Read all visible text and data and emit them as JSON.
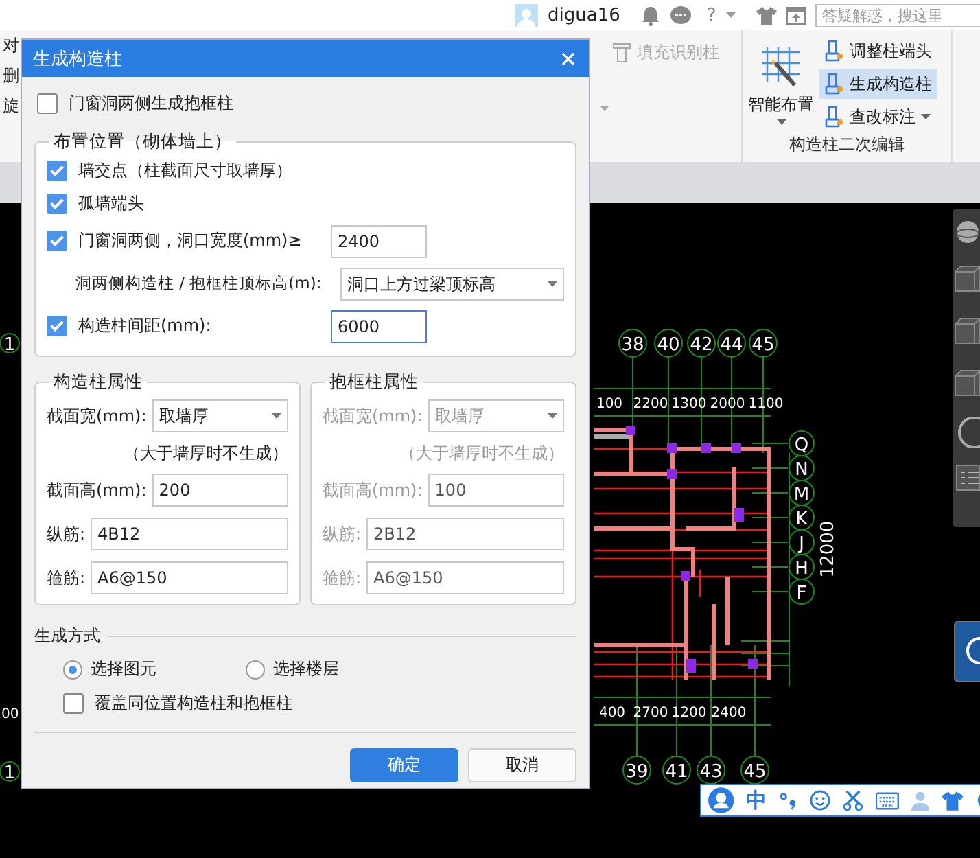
{
  "topbar": {
    "user": "digua16",
    "help": "?",
    "search": {
      "placeholder": "答疑解惑，搜这里"
    }
  },
  "ribbon": {
    "left_items": [
      "对",
      "删",
      "旋"
    ],
    "fill_button": {
      "label": "填充识别柱",
      "disabled": true
    },
    "smart_layout": "智能布置",
    "edit_items": [
      {
        "label": "调整柱端头",
        "selected": false,
        "dropdown": false
      },
      {
        "label": "生成构造柱",
        "selected": true,
        "dropdown": false
      },
      {
        "label": "查改标注",
        "selected": false,
        "dropdown": true
      }
    ],
    "group_label": "构造柱二次编辑"
  },
  "canvas": {
    "top_axes": [
      "38",
      "40",
      "42",
      "44",
      "45"
    ],
    "top_dims": [
      "100",
      "2200",
      "1300",
      "2000",
      "1100"
    ],
    "row_axes": [
      "Q",
      "N",
      "M",
      "K",
      "J",
      "H",
      "F"
    ],
    "side_dim": "12000",
    "bottom_dims": [
      "400",
      "2700",
      "1200",
      "2400"
    ],
    "bottom_axes": [
      "39",
      "41",
      "43",
      "45"
    ],
    "left_axes": [
      "1",
      "1"
    ],
    "left_dim": "00"
  },
  "dialog": {
    "title": "生成构造柱",
    "top_option": {
      "label": "门窗洞两侧生成抱框柱",
      "checked": false
    },
    "placement": {
      "title": "布置位置（砌体墙上）",
      "rows": [
        {
          "kind": "check",
          "label": "墙交点（柱截面尺寸取墙厚）",
          "checked": true
        },
        {
          "kind": "check",
          "label": "孤墙端头",
          "checked": true
        },
        {
          "kind": "check_field",
          "label": "门窗洞两侧，洞口宽度(mm)≥",
          "checked": true,
          "value": "2400",
          "focused": false
        },
        {
          "kind": "select",
          "label": "洞两侧构造柱 / 抱框柱顶标高(m):",
          "value": "洞口上方过梁顶标高"
        },
        {
          "kind": "check_field",
          "label": "构造柱间距(mm):",
          "checked": true,
          "value": "6000",
          "focused": true
        }
      ]
    },
    "panels": [
      {
        "title": "构造柱属性",
        "disabled": false,
        "rows": [
          {
            "kind": "select",
            "label": "截面宽(mm):",
            "value": "取墙厚"
          },
          {
            "kind": "note",
            "label": "（大于墙厚时不生成）"
          },
          {
            "kind": "field",
            "label": "截面高(mm):",
            "value": "200"
          },
          {
            "kind": "field",
            "label": "纵筋:",
            "value": "4B12"
          },
          {
            "kind": "field",
            "label": "箍筋:",
            "value": "A6@150"
          }
        ]
      },
      {
        "title": "抱框柱属性",
        "disabled": true,
        "rows": [
          {
            "kind": "select",
            "label": "截面宽(mm):",
            "value": "取墙厚"
          },
          {
            "kind": "note",
            "label": "（大于墙厚时不生成）"
          },
          {
            "kind": "field",
            "label": "截面高(mm):",
            "value": "100"
          },
          {
            "kind": "field",
            "label": "纵筋:",
            "value": "2B12"
          },
          {
            "kind": "field",
            "label": "箍筋:",
            "value": "A6@150"
          }
        ]
      }
    ],
    "mode": {
      "title": "生成方式",
      "radios": [
        {
          "label": "选择图元",
          "selected": true
        },
        {
          "label": "选择楼层",
          "selected": false
        }
      ],
      "overwrite": {
        "label": "覆盖同位置构造柱和抱框柱",
        "checked": false
      }
    },
    "buttons": [
      {
        "label": "确定",
        "primary": true
      },
      {
        "label": "取消",
        "primary": false
      }
    ]
  },
  "ime": {
    "lang": "中"
  }
}
